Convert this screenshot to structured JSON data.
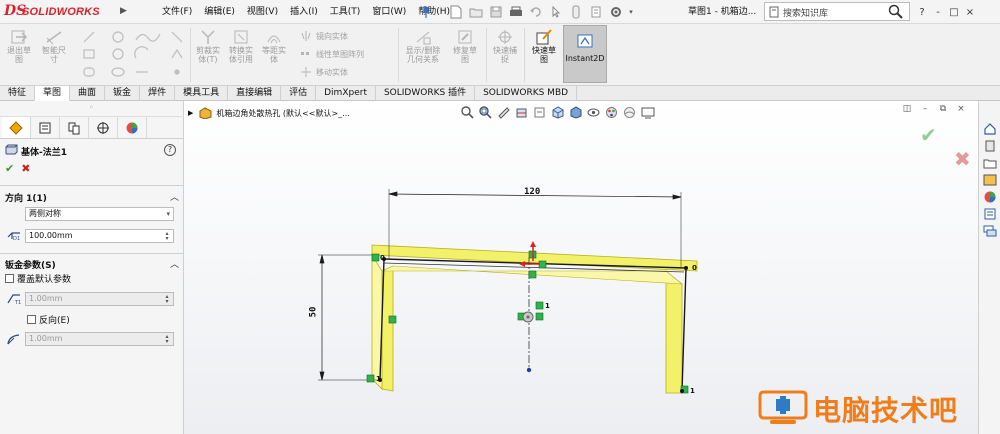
{
  "app": {
    "logo_ds": "DS",
    "logo_text": "SOLIDWORKS",
    "document_title": "草图1 - 机箱边...",
    "search_placeholder": "搜索知识库"
  },
  "menu": [
    "文件(F)",
    "编辑(E)",
    "视图(V)",
    "插入(I)",
    "工具(T)",
    "窗口(W)",
    "帮助(H)"
  ],
  "window_controls": [
    "?",
    "-",
    "□",
    "×"
  ],
  "ribbon": {
    "exit_sketch": "退出草\n图",
    "smart_dim": "智能尺\n寸",
    "trim": "剪裁实\n体(T)",
    "convert": "转换实\n体引用",
    "offset": "等距实\n体",
    "mirror": "镜向实体",
    "linear_pattern": "线性草图阵列",
    "move": "移动实体",
    "display_relations": "显示/删除\n几何关系",
    "repair": "修复草\n图",
    "quick_snaps": "快速捕\n捉",
    "rapid_sketch": "快速草\n图",
    "instant2d": "Instant2D"
  },
  "tabs": [
    "特征",
    "草图",
    "曲面",
    "钣金",
    "焊件",
    "模具工具",
    "直接编辑",
    "评估",
    "DimXpert",
    "SOLIDWORKS 插件",
    "SOLIDWORKS MBD"
  ],
  "active_tab": 1,
  "panel": {
    "feature_title": "基体-法兰1",
    "help": "?",
    "ok": "✔",
    "cancel": "✖",
    "direction_title": "方向 1(1)",
    "end_condition": "两侧对称",
    "depth_value": "100.00mm",
    "sheetmetal_title": "钣金参数(S)",
    "override_label": "覆盖默认参数",
    "thickness_value": "1.00mm",
    "reverse_label": "反向(E)",
    "radius_value": "1.00mm"
  },
  "viewport": {
    "tree_path": "机箱边角处散热孔  (默认<<默认>_...",
    "dim_horizontal": "120",
    "dim_vertical": "50",
    "rel_labels": [
      "0",
      "0",
      "1",
      "1",
      "1"
    ]
  },
  "watermark": "电脑技术吧",
  "colors": {
    "brand_red": "#d6262d",
    "sketch_highlight": "#f3f06a",
    "relation_green": "#2fb34a",
    "watermark_orange": "#f07d1a"
  }
}
